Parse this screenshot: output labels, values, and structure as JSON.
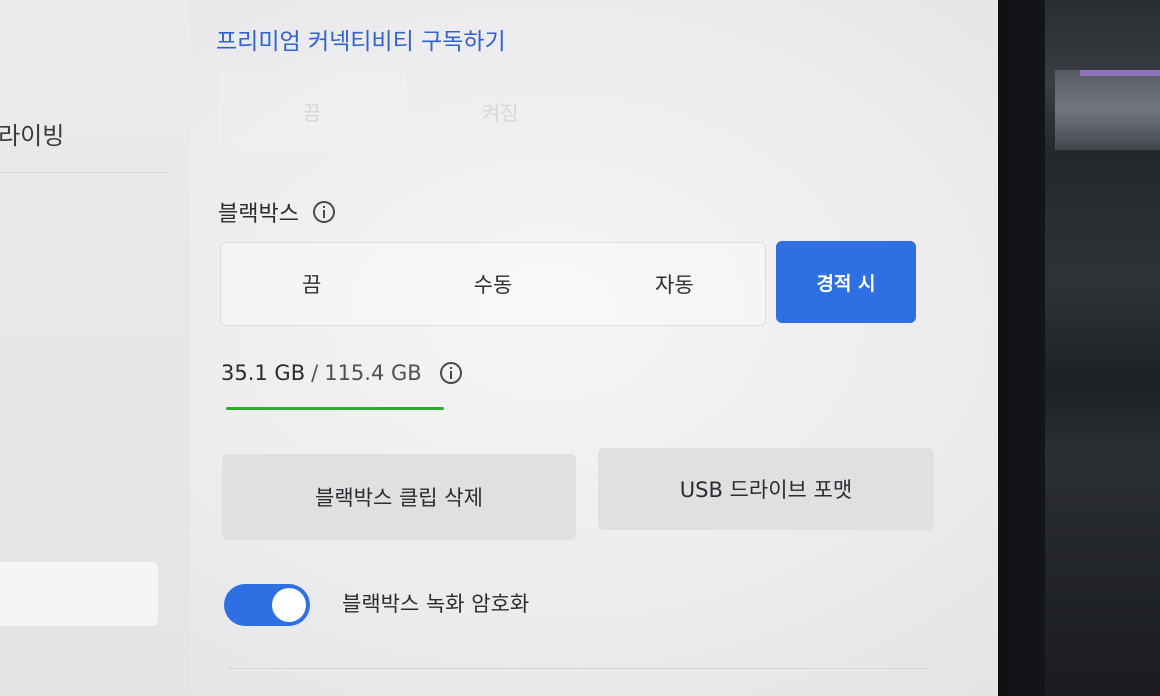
{
  "sidebar": {
    "partial_item": "드라이빙"
  },
  "premium_link": "프리미엄 커넥티비티 구독하기",
  "faded_segment": {
    "options": [
      "끔",
      "켜짐"
    ]
  },
  "dashcam": {
    "title": "블랙박스",
    "options": [
      "끔",
      "수동",
      "자동",
      "경적 시"
    ],
    "selected": "경적 시"
  },
  "storage": {
    "used": "35.1 GB",
    "separator": "/",
    "total": "115.4 GB",
    "used_fraction": 0.304
  },
  "buttons": {
    "delete_clips": "블랙박스 클립 삭제",
    "format_usb": "USB 드라이브 포맷"
  },
  "encryption_toggle": {
    "label": "블랙박스 녹화 암호화",
    "on": true
  },
  "colors": {
    "accent": "#2f6fe4",
    "link": "#2f63d0",
    "storage_bar": "#32a832"
  }
}
